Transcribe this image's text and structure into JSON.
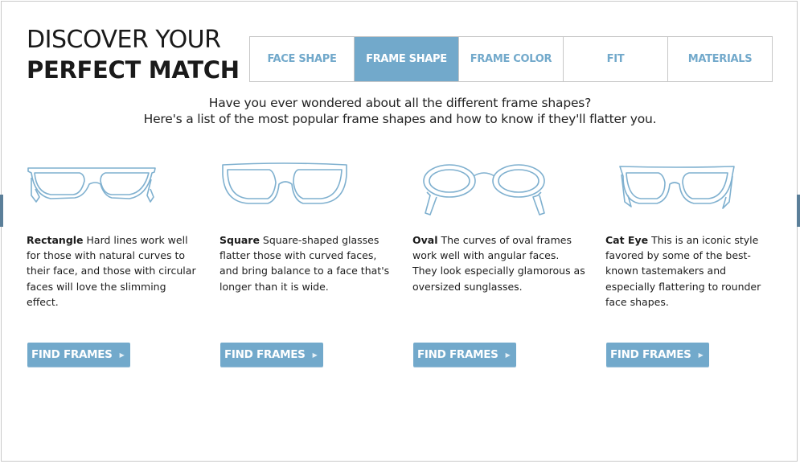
{
  "headline": {
    "line1": "DISCOVER YOUR",
    "line2": "PERFECT MATCH"
  },
  "tabs": [
    {
      "label": "FACE SHAPE",
      "active": false
    },
    {
      "label": "FRAME SHAPE",
      "active": true
    },
    {
      "label": "FRAME COLOR",
      "active": false
    },
    {
      "label": "FIT",
      "active": false
    },
    {
      "label": "MATERIALS",
      "active": false
    }
  ],
  "intro": {
    "line1": "Have you ever wondered about all the different frame shapes?",
    "line2": "Here's a list of the most popular frame shapes and how to know if they'll flatter you."
  },
  "shapes": [
    {
      "name": "Rectangle",
      "icon": "rectangle-glasses-icon",
      "description": "Hard lines work well for those with natural curves to their face, and those with circular faces will love the slimming effect.",
      "button_label": "FIND FRAMES"
    },
    {
      "name": "Square",
      "icon": "square-glasses-icon",
      "description": "Square-shaped glasses flatter those with curved faces, and bring balance to a face that's longer than it is wide.",
      "button_label": "FIND FRAMES"
    },
    {
      "name": "Oval",
      "icon": "oval-glasses-icon",
      "description": "The curves of oval frames work well with angular faces. They look especially glamorous as oversized sunglasses.",
      "button_label": "FIND FRAMES"
    },
    {
      "name": "Cat Eye",
      "icon": "cat-eye-glasses-icon",
      "description": "This is an iconic style favored by some of the best-known tastemakers and especially flattering to rounder face shapes.",
      "button_label": "FIND FRAMES"
    }
  ],
  "colors": {
    "accent": "#72a9cb",
    "outline": "#7fb0cf",
    "text": "#1c1c1c"
  }
}
